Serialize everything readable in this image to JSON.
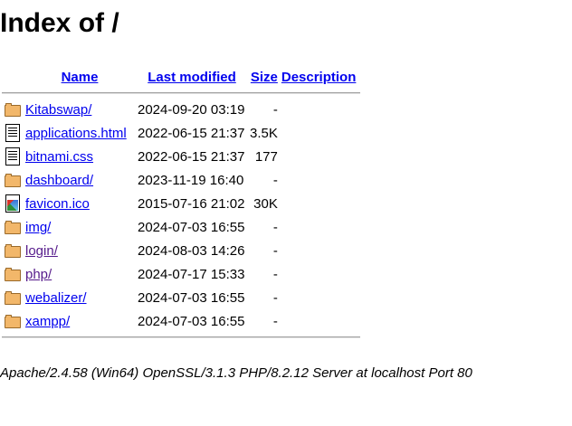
{
  "page": {
    "title": "Index of /"
  },
  "columns": {
    "name": "Name",
    "last_modified": "Last modified",
    "size": "Size",
    "description": "Description"
  },
  "entries": [
    {
      "name": "Kitabswap/",
      "modified": "2024-09-20 03:19",
      "size": "-",
      "icon": "folder-icon",
      "visited": false
    },
    {
      "name": "applications.html",
      "modified": "2022-06-15 21:37",
      "size": "3.5K",
      "icon": "text-file-icon",
      "visited": false
    },
    {
      "name": "bitnami.css",
      "modified": "2022-06-15 21:37",
      "size": "177",
      "icon": "text-file-icon",
      "visited": false
    },
    {
      "name": "dashboard/",
      "modified": "2023-11-19 16:40",
      "size": "-",
      "icon": "folder-icon",
      "visited": false
    },
    {
      "name": "favicon.ico",
      "modified": "2015-07-16 21:02",
      "size": "30K",
      "icon": "image-file-icon",
      "visited": false
    },
    {
      "name": "img/",
      "modified": "2024-07-03 16:55",
      "size": "-",
      "icon": "folder-icon",
      "visited": false
    },
    {
      "name": "login/",
      "modified": "2024-08-03 14:26",
      "size": "-",
      "icon": "folder-icon",
      "visited": true
    },
    {
      "name": "php/",
      "modified": "2024-07-17 15:33",
      "size": "-",
      "icon": "folder-icon",
      "visited": true
    },
    {
      "name": "webalizer/",
      "modified": "2024-07-03 16:55",
      "size": "-",
      "icon": "folder-icon",
      "visited": false
    },
    {
      "name": "xampp/",
      "modified": "2024-07-03 16:55",
      "size": "-",
      "icon": "folder-icon",
      "visited": false
    }
  ],
  "footer": {
    "server_signature": "Apache/2.4.58 (Win64) OpenSSL/3.1.3 PHP/8.2.12 Server at localhost Port 80"
  },
  "colors": {
    "link": "#0000ee",
    "visited_link": "#551a8b",
    "folder": "#f2b76a"
  }
}
